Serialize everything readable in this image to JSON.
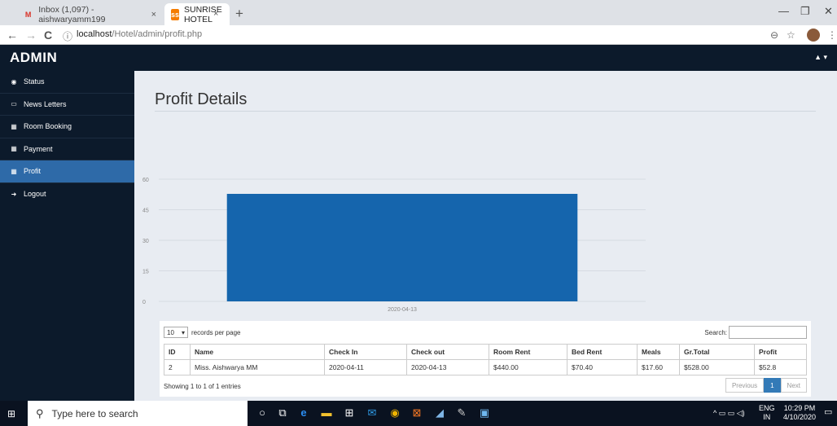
{
  "browser": {
    "tabs": [
      {
        "label": "Inbox (1,097) - aishwaryamm199",
        "favicon": "M",
        "close": "×"
      },
      {
        "label": "SUNRISE HOTEL",
        "favicon": "ss",
        "close": "×"
      }
    ],
    "new_tab": "+",
    "url_host": "localhost",
    "url_path": "/Hotel/admin/profit.php",
    "info_icon": "ⓘ",
    "back": "←",
    "forward": "→",
    "reload": "C",
    "zoom_icon": "⊖",
    "star_icon": "☆",
    "menu_icon": "⋮",
    "min": "—",
    "max": "❐",
    "close": "✕"
  },
  "header": {
    "brand": "ADMIN",
    "user_icon": "▲ ▾"
  },
  "sidebar": {
    "items": [
      {
        "label": "Status",
        "icon": "dashboard-icon",
        "glyph": "◉"
      },
      {
        "label": "News Letters",
        "icon": "desktop-icon",
        "glyph": "▭"
      },
      {
        "label": "Room Booking",
        "icon": "bar-chart-icon",
        "glyph": "▦"
      },
      {
        "label": "Payment",
        "icon": "table-icon",
        "glyph": "▦"
      },
      {
        "label": "Profit",
        "icon": "table-icon",
        "glyph": "▦"
      },
      {
        "label": "Logout",
        "icon": "sign-out-icon",
        "glyph": "➜"
      }
    ]
  },
  "main": {
    "title": "Profit Details"
  },
  "chart_data": {
    "type": "bar",
    "categories": [
      "2020-04-13"
    ],
    "values": [
      52.8
    ],
    "ylim": [
      0,
      60
    ],
    "yticks": [
      0,
      15,
      30,
      45,
      60
    ],
    "color": "#1565ad",
    "title": "",
    "xlabel": "",
    "ylabel": ""
  },
  "table": {
    "length_value": "10",
    "length_label": "records per page",
    "search_label": "Search:",
    "columns": [
      "ID",
      "Name",
      "Check In",
      "Check out",
      "Room Rent",
      "Bed Rent",
      "Meals",
      "Gr.Total",
      "Profit"
    ],
    "rows": [
      [
        "2",
        "Miss. Aishwarya MM",
        "2020-04-11",
        "2020-04-13",
        "$440.00",
        "$70.40",
        "$17.60",
        "$528.00",
        "$52.8"
      ]
    ],
    "info": "Showing 1 to 1 of 1 entries",
    "pager": {
      "previous": "Previous",
      "current": "1",
      "next": "Next"
    }
  },
  "taskbar": {
    "search_placeholder": "Type here to search",
    "lang": "ENG",
    "region": "IN",
    "time": "10:29 PM",
    "date": "4/10/2020"
  }
}
